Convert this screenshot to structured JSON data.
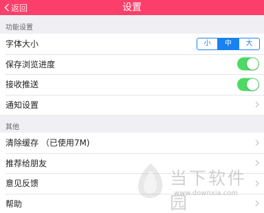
{
  "nav": {
    "back_label": "返回",
    "title": "设置",
    "background": "#fb3f6a"
  },
  "sections": [
    {
      "title": "功能设置"
    },
    {
      "title": "其他"
    }
  ],
  "function_rows": {
    "font_size": {
      "label": "字体大小",
      "options": [
        "小",
        "中",
        "大"
      ],
      "selected": "中"
    },
    "save_progress": {
      "label": "保存浏览进度",
      "on": true
    },
    "receive_push": {
      "label": "接收推送",
      "on": true
    },
    "notification": {
      "label": "通知设置"
    }
  },
  "other_rows": {
    "clear_cache": {
      "label": "清除缓存 （已使用7M)"
    },
    "recommend": {
      "label": "推荐给朋友"
    },
    "feedback": {
      "label": "意见反馈"
    },
    "help": {
      "label": "帮助"
    }
  },
  "watermark": {
    "name": "当下软件园",
    "url": "www.downxia.com"
  },
  "colors": {
    "toggle_on": "#4cd964",
    "segment_accent": "#1a82f0",
    "background": "#efeff4"
  }
}
